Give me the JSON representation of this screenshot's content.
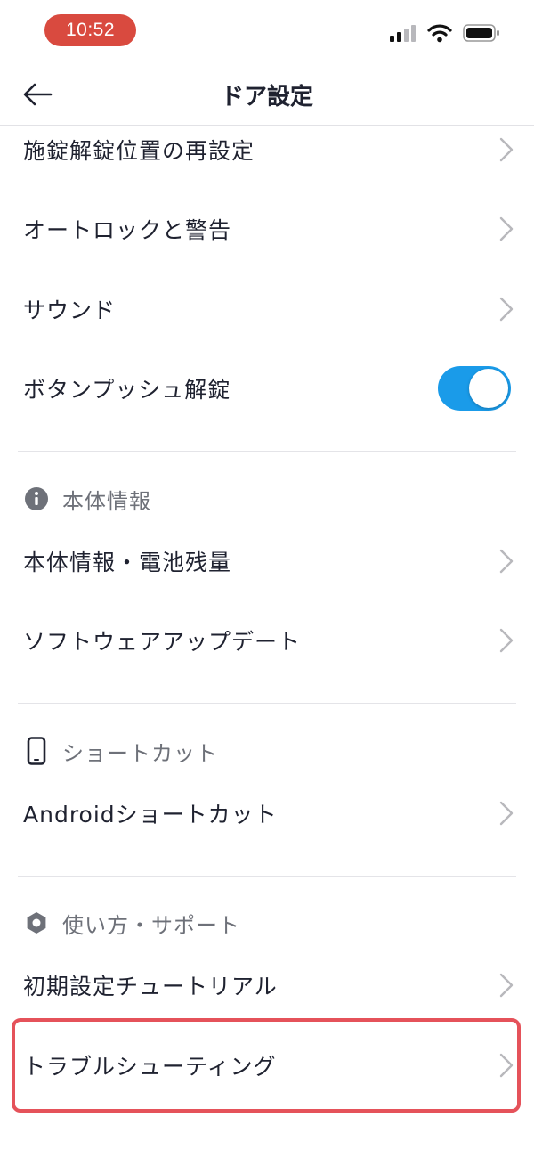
{
  "status": {
    "time": "10:52"
  },
  "header": {
    "title": "ドア設定"
  },
  "settings": {
    "lock_position": "施錠解錠位置の再設定",
    "autolock": "オートロックと警告",
    "sound": "サウンド",
    "button_push": "ボタンプッシュ解錠",
    "button_push_enabled": true
  },
  "device_info": {
    "section_title": "本体情報",
    "info_battery": "本体情報・電池残量",
    "software_update": "ソフトウェアアップデート"
  },
  "shortcut": {
    "section_title": "ショートカット",
    "android_shortcut": "Androidショートカット"
  },
  "support": {
    "section_title": "使い方・サポート",
    "tutorial": "初期設定チュートリアル",
    "troubleshooting": "トラブルシューティング"
  },
  "colors": {
    "accent": "#1a9be9",
    "highlight": "#e5525a",
    "time_pill": "#d94a3f"
  }
}
